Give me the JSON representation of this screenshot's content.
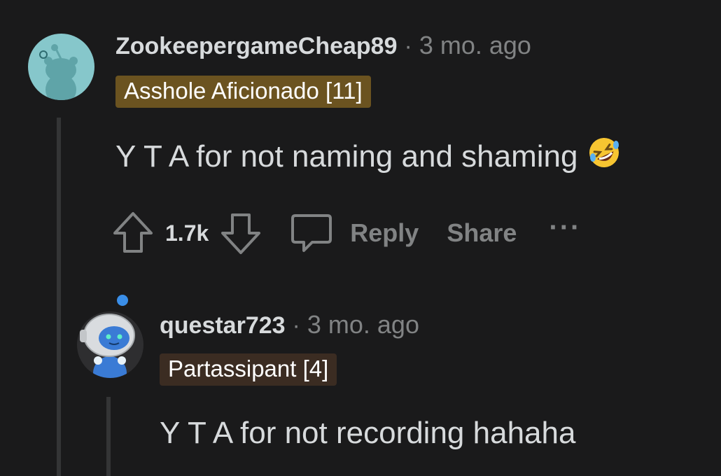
{
  "comment": {
    "username": "ZookeepergameCheap89",
    "separator": "·",
    "timestamp": "3 mo. ago",
    "flair": "Asshole Aficionado [11]",
    "flair_color": "#6b5320",
    "body": "Y T A for not naming and shaming",
    "emoji": "rolling-on-floor-laughing",
    "score": "1.7k",
    "actions": {
      "reply": "Reply",
      "share": "Share",
      "more": "···"
    },
    "avatar_color": "#86c7cb"
  },
  "reply": {
    "username": "questar723",
    "separator": "·",
    "timestamp": "3 mo. ago",
    "flair": "Partassipant [4]",
    "flair_color": "#3b2c22",
    "body": "Y T A for not recording hahaha"
  }
}
